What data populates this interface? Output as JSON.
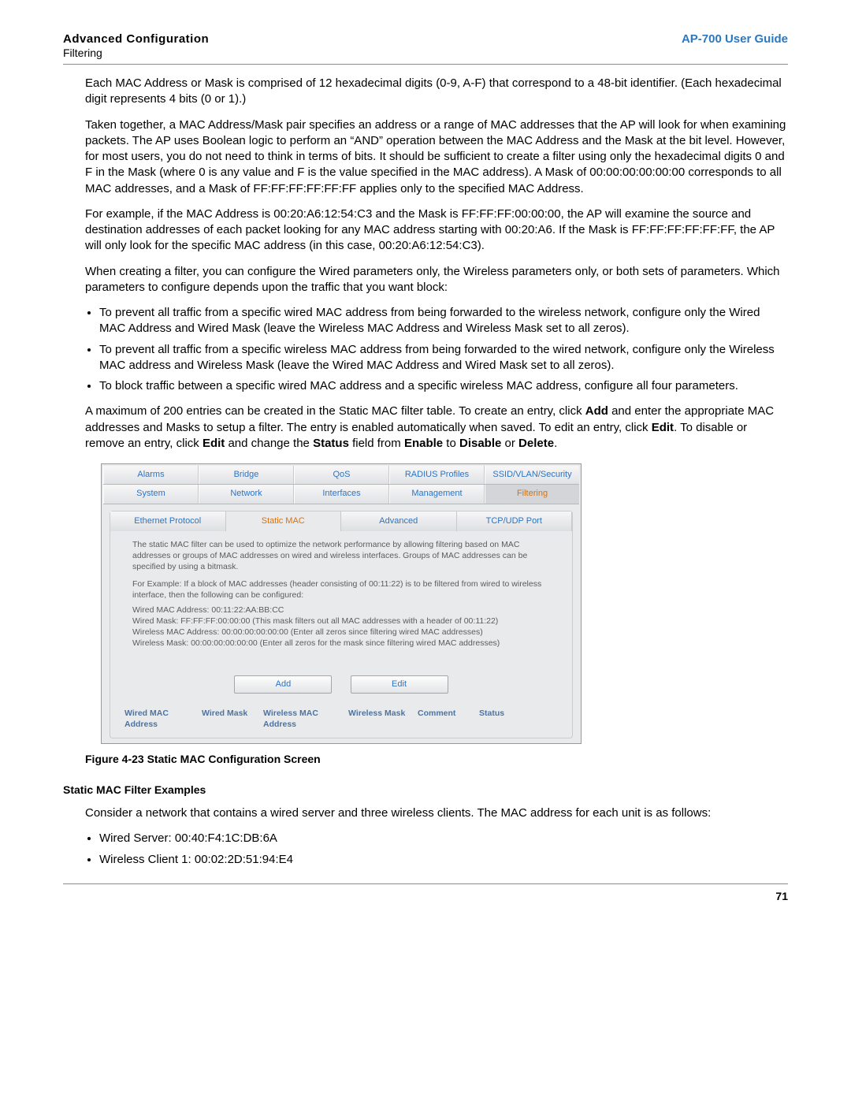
{
  "header": {
    "title_bold": "Advanced Configuration",
    "subtitle": "Filtering",
    "right": "AP-700 User Guide"
  },
  "body": {
    "p1": "Each MAC Address or Mask is comprised of 12 hexadecimal digits (0-9, A-F) that correspond to a 48-bit identifier. (Each hexadecimal digit represents 4 bits (0 or 1).)",
    "p2": "Taken together, a MAC Address/Mask pair specifies an address or a range of MAC addresses that the AP will look for when examining packets. The AP uses Boolean logic to perform an “AND” operation between the MAC Address and the Mask at the bit level. However, for most users, you do not need to think in terms of bits. It should be sufficient to create a filter using only the hexadecimal digits 0 and F in the Mask (where 0 is any value and F is the value specified in the MAC address). A Mask of 00:00:00:00:00:00 corresponds to all MAC addresses, and a Mask of FF:FF:FF:FF:FF:FF applies only to the specified MAC Address.",
    "p3": "For example, if the MAC Address is 00:20:A6:12:54:C3 and the Mask is FF:FF:FF:00:00:00, the AP will examine the source and destination addresses of each packet looking for any MAC address starting with 00:20:A6. If the Mask is FF:FF:FF:FF:FF:FF, the AP will only look for the specific MAC address (in this case, 00:20:A6:12:54:C3).",
    "p4": "When creating a filter, you can configure the Wired parameters only, the Wireless parameters only, or both sets of parameters. Which parameters to configure depends upon the traffic that you want block:",
    "bullets1": [
      "To prevent all traffic from a specific wired MAC address from being forwarded to the wireless network, configure only the Wired MAC Address and Wired Mask (leave the Wireless MAC Address and Wireless Mask set to all zeros).",
      "To prevent all traffic from a specific wireless MAC address from being forwarded to the wired network, configure only the Wireless MAC address and Wireless Mask (leave the Wired MAC Address and Wired Mask set to all zeros).",
      "To block traffic between a specific wired MAC address and a specific wireless MAC address, configure all four parameters."
    ],
    "p5a": "A maximum of 200 entries can be created in the Static MAC filter table. To create an entry, click ",
    "p5_add": "Add",
    "p5b": " and enter the appropriate MAC addresses and Masks to setup a filter. The entry is enabled automatically when saved. To edit an entry, click ",
    "p5_edit": "Edit",
    "p5c": ". To disable or remove an entry, click ",
    "p5_edit2": "Edit",
    "p5d": " and change the ",
    "p5_status": "Status",
    "p5e": " field from ",
    "p5_enable": "Enable",
    "p5f": " to ",
    "p5_disable": "Disable",
    "p5g": " or ",
    "p5_delete": "Delete",
    "p5h": "."
  },
  "ui": {
    "tabs1": {
      "a": "Alarms",
      "b": "Bridge",
      "c": "QoS",
      "d": "RADIUS Profiles",
      "e": "SSID/VLAN/Security"
    },
    "tabs2": {
      "a": "System",
      "b": "Network",
      "c": "Interfaces",
      "d": "Management",
      "e": "Filtering"
    },
    "subtabs": {
      "a": "Ethernet Protocol",
      "b": "Static MAC",
      "c": "Advanced",
      "d": "TCP/UDP Port"
    },
    "info1": "The static MAC filter can be used to optimize the network performance by allowing filtering based on MAC addresses or groups of MAC addresses on wired and wireless interfaces. Groups of MAC addresses can be specified by using a bitmask.",
    "info2": "For Example: If a block of MAC addresses (header consisting of 00:11:22) is to be filtered from wired to wireless interface, then the following can be configured:",
    "info3a": "Wired MAC Address: 00:11:22:AA:BB:CC",
    "info3b": "Wired Mask: FF:FF:FF:00:00:00 (This mask filters out all MAC addresses with a header of 00:11:22)",
    "info3c": "Wireless MAC Address: 00:00:00:00:00:00 (Enter all zeros since filtering wired MAC addresses)",
    "info3d": "Wireless Mask: 00:00:00:00:00:00 (Enter all zeros for the mask since filtering wired MAC addresses)",
    "buttons": {
      "add": "Add",
      "edit": "Edit"
    },
    "cols": {
      "c1": "Wired MAC Address",
      "c2": "Wired Mask",
      "c3": "Wireless MAC Address",
      "c4": "Wireless Mask",
      "c5": "Comment",
      "c6": "Status"
    }
  },
  "caption": "Figure 4-23 Static MAC Configuration Screen",
  "examples": {
    "heading": "Static MAC Filter Examples",
    "intro": "Consider a network that contains a wired server and three wireless clients. The MAC address for each unit is as follows:",
    "items": [
      "Wired Server: 00:40:F4:1C:DB:6A",
      "Wireless Client 1: 00:02:2D:51:94:E4"
    ]
  },
  "page_number": "71"
}
